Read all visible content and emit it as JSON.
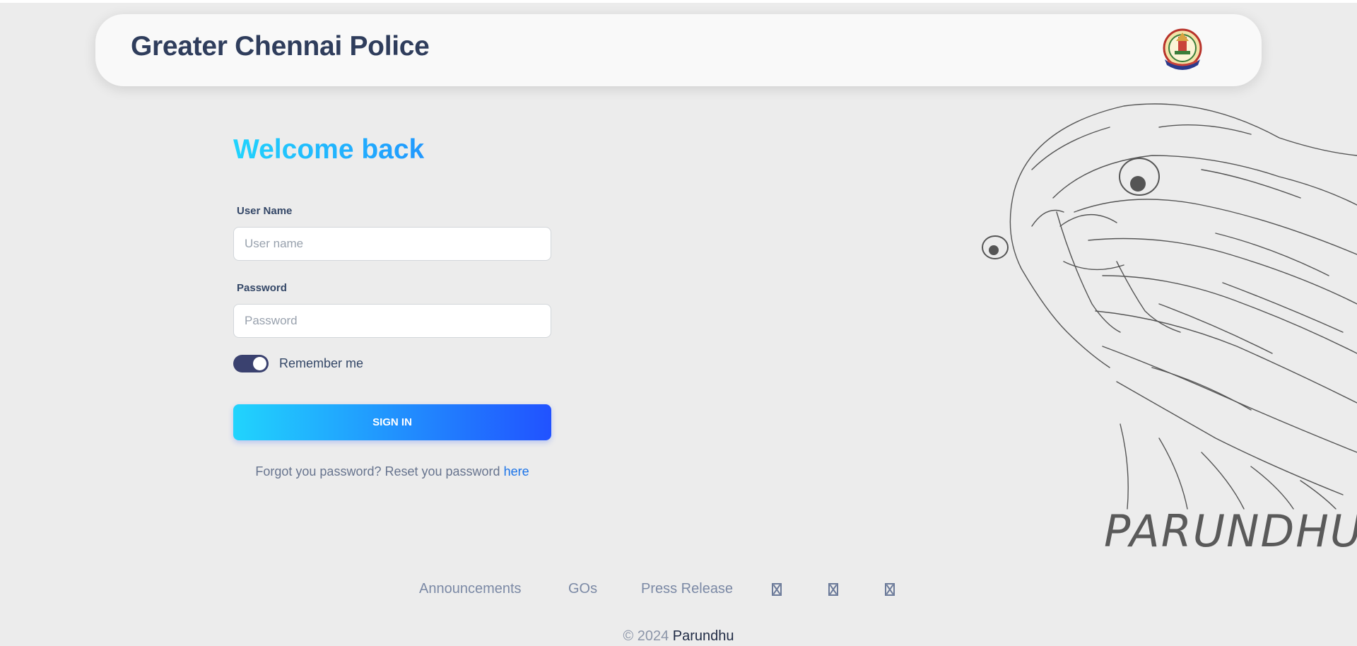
{
  "header": {
    "brand": "Greater Chennai Police",
    "emblem_icon": "police-emblem"
  },
  "login": {
    "heading": "Welcome back",
    "username_label": "User Name",
    "username_placeholder": "User name",
    "username_value": "",
    "password_label": "Password",
    "password_placeholder": "Password",
    "password_value": "",
    "remember_label": "Remember me",
    "remember_on": true,
    "signin_label": "SIGN IN",
    "forgot_text": "Forgot you password? Reset you password",
    "forgot_link": "here"
  },
  "illustration": {
    "label": "PARUNDHU"
  },
  "footer": {
    "links": [
      "Announcements",
      "GOs",
      "Press Release"
    ],
    "social_icons": [
      "broken-glyph-icon",
      "broken-glyph-icon",
      "broken-glyph-icon"
    ],
    "copyright_prefix": "© 2024",
    "copyright_owner": "Parundhu"
  },
  "colors": {
    "background": "#ececec",
    "brand_text": "#2f3d5c",
    "gradient_start": "#21d4fd",
    "gradient_end": "#2152ff",
    "toggle": "#3a416f",
    "link": "#1a73e8"
  }
}
